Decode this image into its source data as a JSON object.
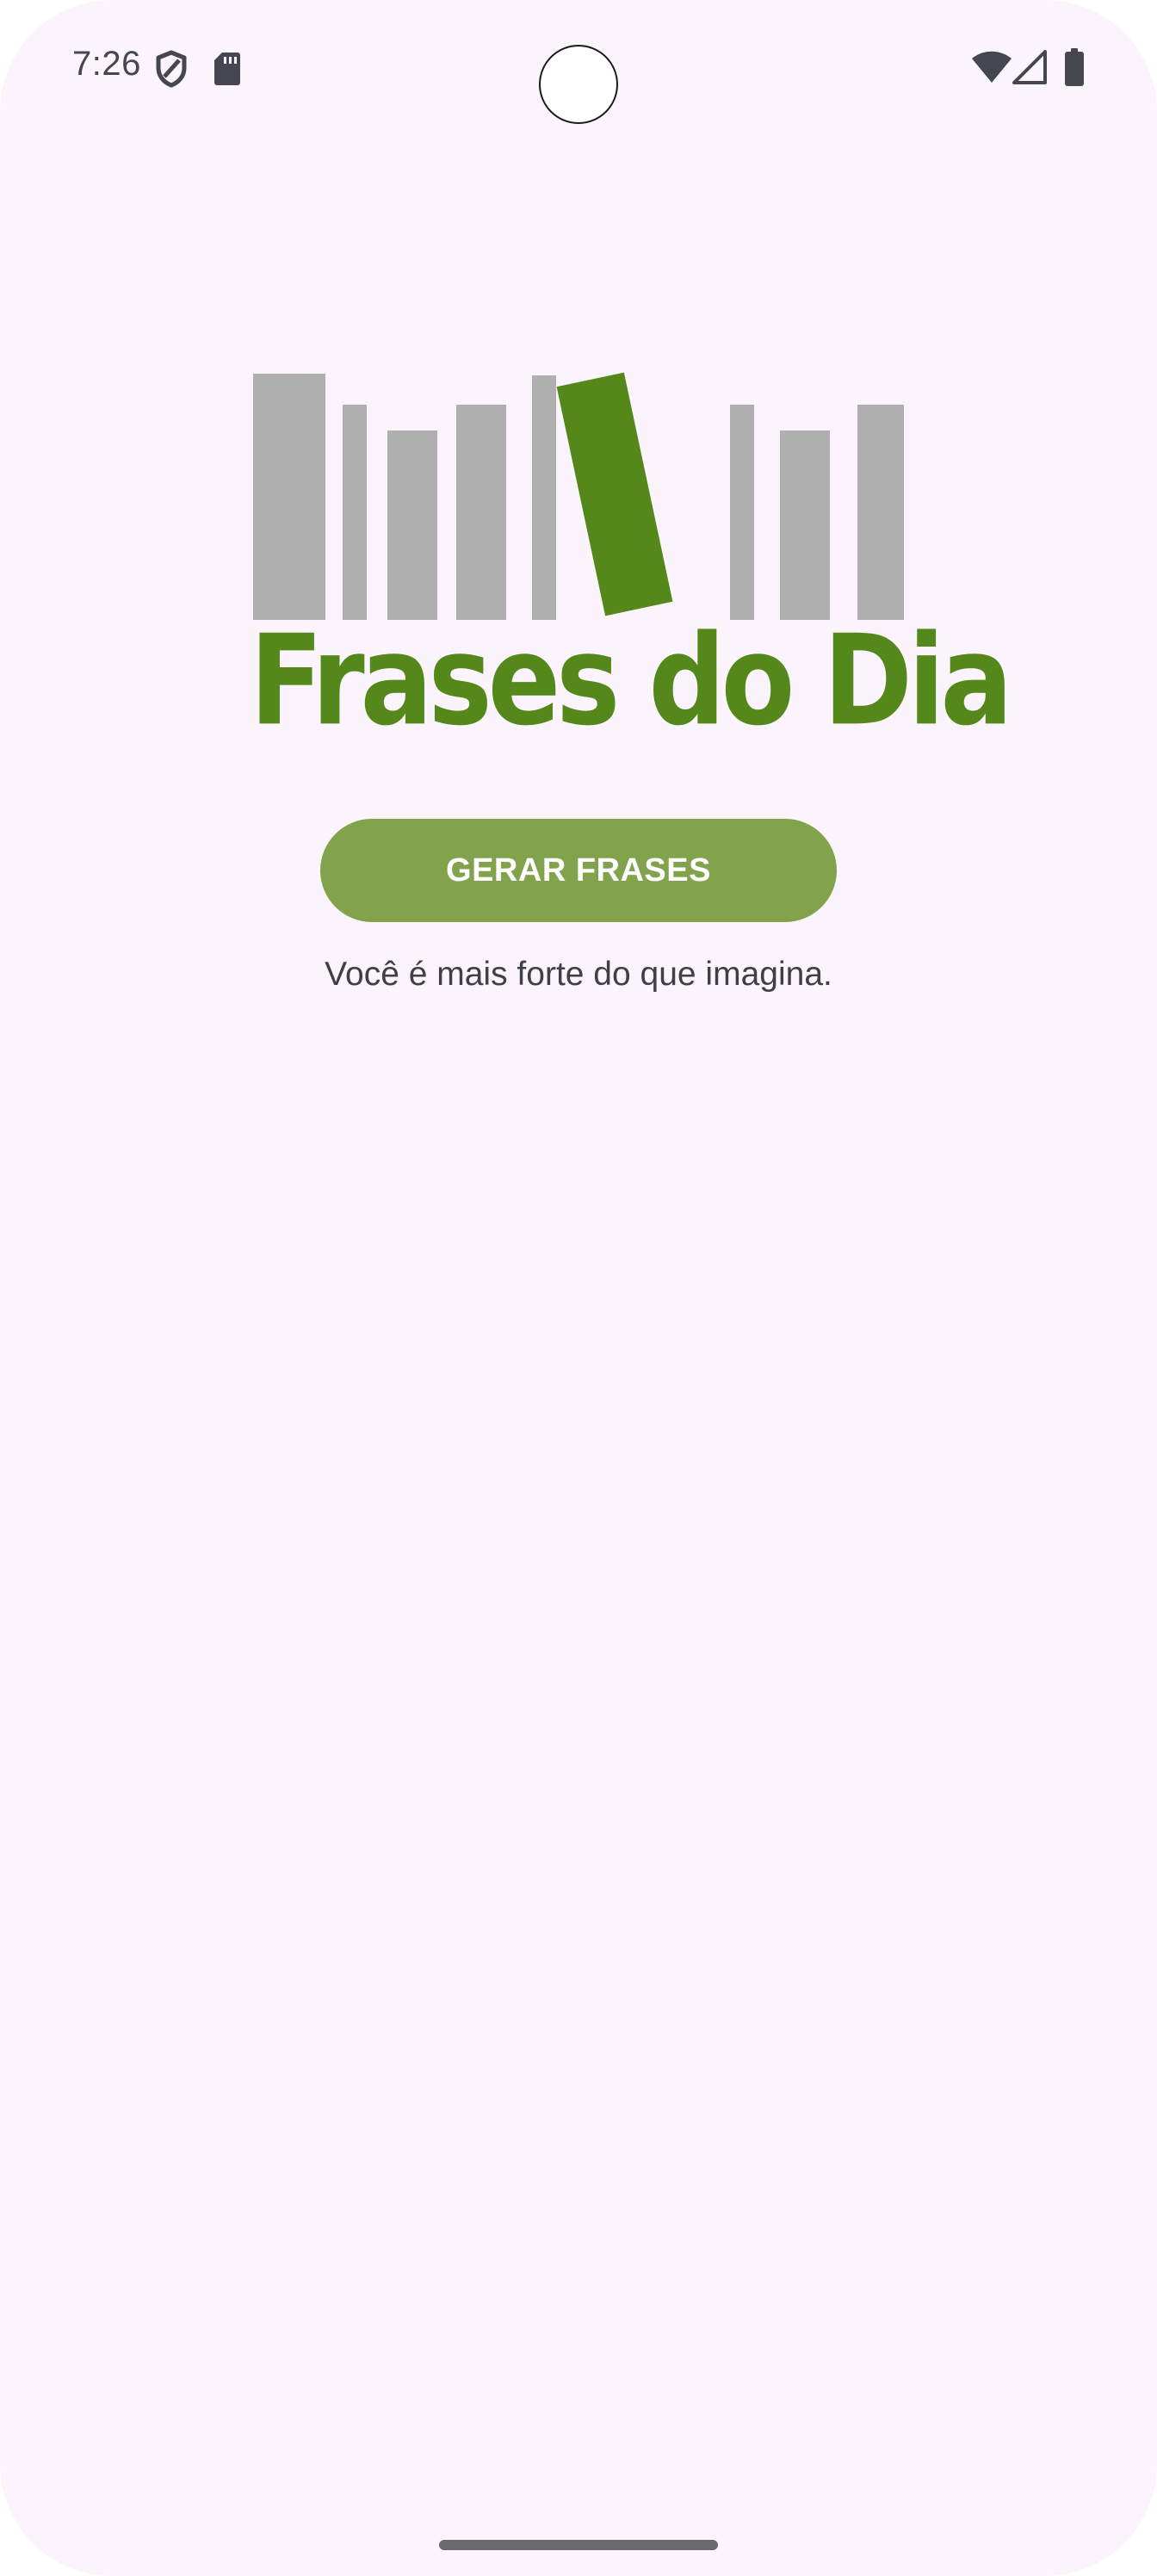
{
  "status_bar": {
    "time": "7:26",
    "left_icons": [
      "shield-icon",
      "sd-card-icon"
    ],
    "right_icons": [
      "wifi-icon",
      "cellular-signal-icon",
      "battery-icon"
    ]
  },
  "logo": {
    "text": "Frases do Dia",
    "text_color": "#55881b",
    "book_gray": "#afafaf",
    "book_green": "#55881b"
  },
  "main": {
    "generate_button_label": "GERAR FRASES",
    "phrase_text": "Você é mais forte do que imagina."
  },
  "colors": {
    "background": "#fcf4fc",
    "button": "#82a34b",
    "button_text": "#ffffff",
    "phrase_text": "#3f3f46"
  }
}
